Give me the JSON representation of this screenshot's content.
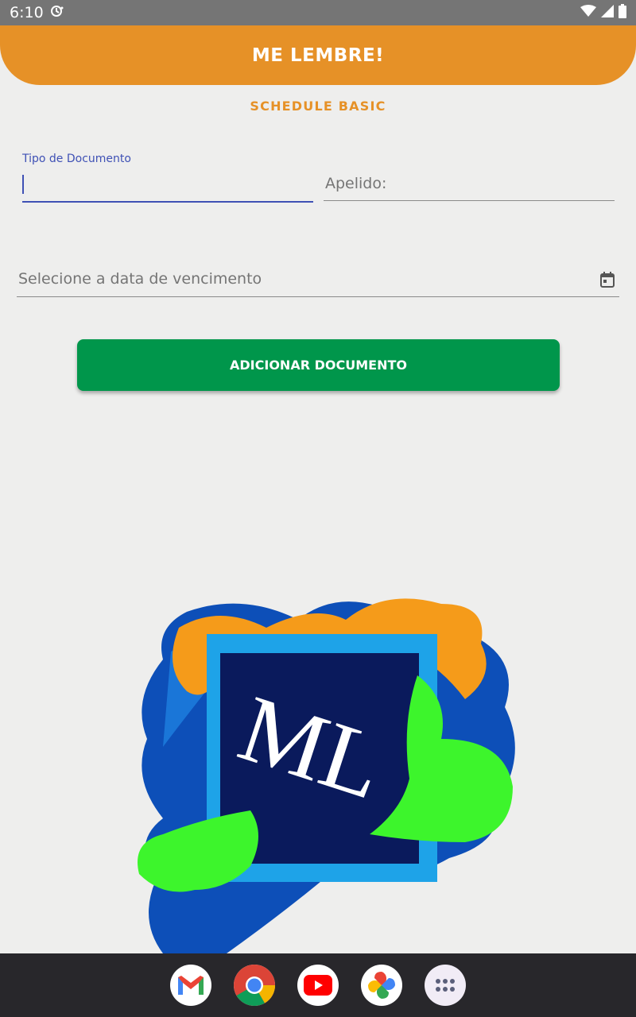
{
  "status": {
    "time": "6:10"
  },
  "app": {
    "title": "ME LEMBRE!",
    "subtitle": "SCHEDULE BASIC"
  },
  "form": {
    "doc_type": {
      "label": "Tipo de Documento",
      "value": ""
    },
    "nickname": {
      "placeholder": "Apelido:"
    },
    "due_date": {
      "placeholder": "Selecione a data de vencimento"
    },
    "add_button_label": "ADICIONAR DOCUMENTO"
  },
  "logo": {
    "text": "ML"
  },
  "colors": {
    "header": "#e69127",
    "button": "#00964b",
    "focus": "#3f51b5",
    "logo_navy": "#0a1a5c"
  },
  "dock": [
    "gmail-icon",
    "chrome-icon",
    "youtube-icon",
    "photos-icon",
    "apps-drawer-icon"
  ]
}
